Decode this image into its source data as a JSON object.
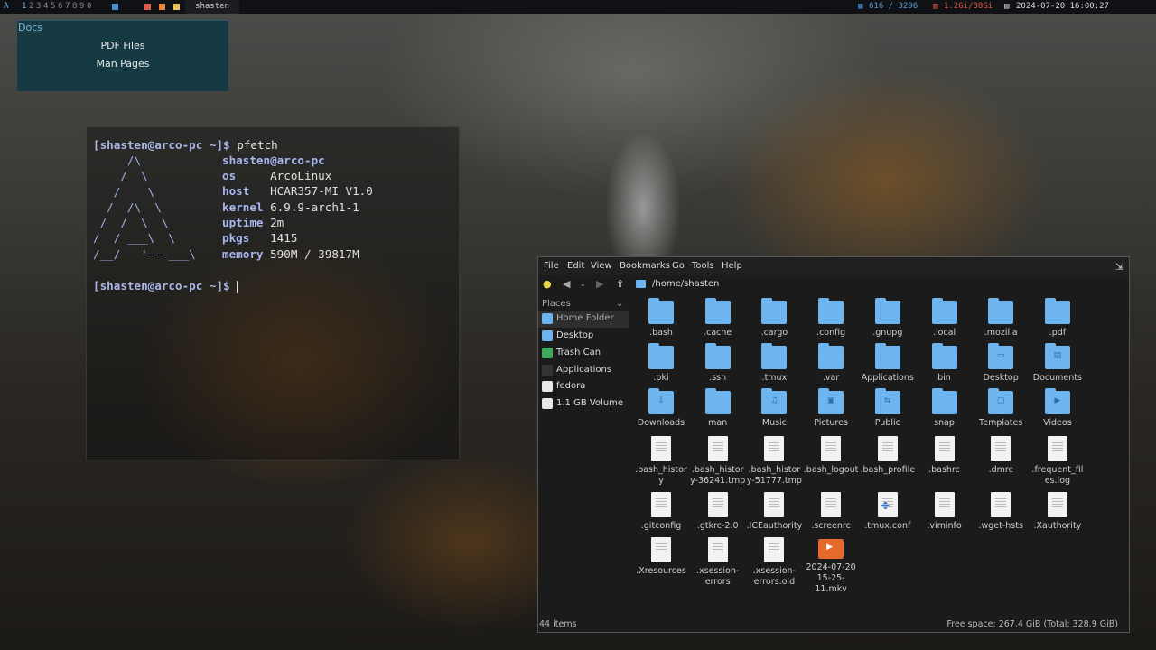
{
  "topbar": {
    "launcher": "A",
    "workspaces": [
      "1",
      "2",
      "3",
      "4",
      "5",
      "6",
      "7",
      "8",
      "9",
      "0"
    ],
    "active_workspace": "1",
    "window_title": "shasten",
    "cpu": "616 / 3296",
    "mem": "1.2Gi/38Gi",
    "datetime": "2024-07-20 16:00:27"
  },
  "docs_menu": {
    "title": "Docs",
    "items": [
      "PDF Files",
      "Man Pages"
    ]
  },
  "terminal": {
    "prompt": "[shasten@arco-pc ~]$",
    "command": "pfetch",
    "logo": [
      "     /\\",
      "    /  \\",
      "   /    \\",
      "  /  /\\  \\",
      " /  /  \\  \\",
      "/  / ___\\  \\",
      "/__/   '---___\\"
    ],
    "user_host": "shasten@arco-pc",
    "info": [
      {
        "key": "os",
        "value": "ArcoLinux"
      },
      {
        "key": "host",
        "value": "HCAR357-MI V1.0"
      },
      {
        "key": "kernel",
        "value": "6.9.9-arch1-1"
      },
      {
        "key": "uptime",
        "value": "2m"
      },
      {
        "key": "pkgs",
        "value": "1415"
      },
      {
        "key": "memory",
        "value": "590M / 39817M"
      }
    ]
  },
  "file_manager": {
    "menu": [
      "File",
      "Edit",
      "View",
      "Bookmarks",
      "Go",
      "Tools",
      "Help"
    ],
    "path": "/home/shasten",
    "places_label": "Places",
    "places": [
      "Home Folder",
      "Desktop",
      "Trash Can",
      "Applications",
      "fedora",
      "1.1 GB Volume"
    ],
    "files": [
      {
        "name": ".bash",
        "type": "folder"
      },
      {
        "name": ".cache",
        "type": "folder"
      },
      {
        "name": ".cargo",
        "type": "folder"
      },
      {
        "name": ".config",
        "type": "folder"
      },
      {
        "name": ".gnupg",
        "type": "folder"
      },
      {
        "name": ".local",
        "type": "folder"
      },
      {
        "name": ".mozilla",
        "type": "folder"
      },
      {
        "name": ".pdf",
        "type": "folder"
      },
      {
        "name": ".pki",
        "type": "folder"
      },
      {
        "name": ".ssh",
        "type": "folder"
      },
      {
        "name": ".tmux",
        "type": "folder"
      },
      {
        "name": ".var",
        "type": "folder"
      },
      {
        "name": "Applications",
        "type": "folder"
      },
      {
        "name": "bin",
        "type": "folder"
      },
      {
        "name": "Desktop",
        "type": "folder"
      },
      {
        "name": "Documents",
        "type": "folder"
      },
      {
        "name": "Downloads",
        "type": "folder"
      },
      {
        "name": "man",
        "type": "folder"
      },
      {
        "name": "Music",
        "type": "folder"
      },
      {
        "name": "Pictures",
        "type": "folder"
      },
      {
        "name": "Public",
        "type": "folder"
      },
      {
        "name": "snap",
        "type": "folder"
      },
      {
        "name": "Templates",
        "type": "folder"
      },
      {
        "name": "Videos",
        "type": "folder"
      },
      {
        "name": ".bash_history",
        "type": "doc"
      },
      {
        "name": ".bash_history-36241.tmp",
        "type": "doc"
      },
      {
        "name": ".bash_history-51777.tmp",
        "type": "doc"
      },
      {
        "name": ".bash_logout",
        "type": "doc"
      },
      {
        "name": ".bash_profile",
        "type": "doc"
      },
      {
        "name": ".bashrc",
        "type": "doc"
      },
      {
        "name": ".dmrc",
        "type": "doc"
      },
      {
        "name": ".frequent_files.log",
        "type": "doc"
      },
      {
        "name": ".gitconfig",
        "type": "doc"
      },
      {
        "name": ".gtkrc-2.0",
        "type": "doc"
      },
      {
        "name": ".ICEauthority",
        "type": "doc"
      },
      {
        "name": ".screenrc",
        "type": "doc"
      },
      {
        "name": ".tmux.conf",
        "type": "tmux"
      },
      {
        "name": ".viminfo",
        "type": "doc"
      },
      {
        "name": ".wget-hsts",
        "type": "doc"
      },
      {
        "name": ".Xauthority",
        "type": "doc"
      },
      {
        "name": ".Xresources",
        "type": "doc"
      },
      {
        "name": ".xsession-errors",
        "type": "doc"
      },
      {
        "name": ".xsession-errors.old",
        "type": "doc"
      },
      {
        "name": "2024-07-20 15-25-11.mkv",
        "type": "video"
      }
    ],
    "status_items": "44 items",
    "status_free": "Free space: 267.4 GiB (Total: 328.9 GiB)"
  }
}
